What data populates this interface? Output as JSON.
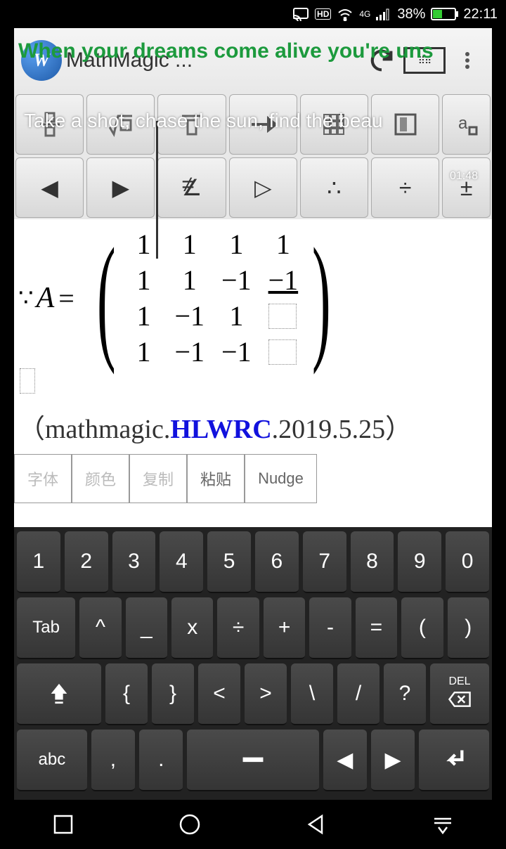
{
  "status": {
    "battery_pct": "38%",
    "time": "22:11",
    "net": "4G",
    "hd": "HD"
  },
  "title": "MathMagic ...",
  "overlay": {
    "lyric1": "When your dreams come alive you're uns",
    "lyric2": "Take a shot, chase the sun, find the beau",
    "time": "01:48"
  },
  "doc": {
    "prefix": "∵",
    "label": "A",
    "eq": "=",
    "matrix": [
      [
        "1",
        "1",
        "1",
        "1"
      ],
      [
        "1",
        "1",
        "−1",
        "−1"
      ],
      [
        "1",
        "−1",
        "1",
        "□"
      ],
      [
        "1",
        "−1",
        "−1",
        "□"
      ]
    ],
    "line2_pre": "（mathmagic.",
    "line2_hl": "HLWRC",
    "line2_post": ".2019.5.25）"
  },
  "tabs": {
    "font": "字体",
    "color": "颜色",
    "copy": "复制",
    "paste": "粘贴",
    "nudge": "Nudge"
  },
  "kb": {
    "r1": [
      "1",
      "2",
      "3",
      "4",
      "5",
      "6",
      "7",
      "8",
      "9",
      "0"
    ],
    "r2": [
      "Tab",
      "^",
      "_",
      "x",
      "÷",
      "+",
      "-",
      "=",
      "(",
      ")"
    ],
    "r3_shift": "⇧",
    "r3": [
      "{",
      "}",
      "<",
      ">",
      "\\",
      "/",
      "?"
    ],
    "r3_del_top": "DEL",
    "r4_abc": "abc",
    "r4": [
      ",",
      "."
    ],
    "r4_space": " "
  }
}
